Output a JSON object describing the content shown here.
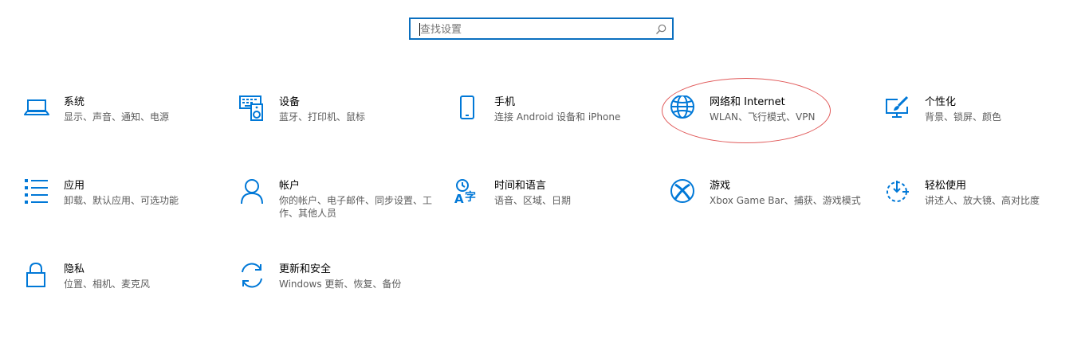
{
  "search": {
    "placeholder": "查找设置",
    "icon": "search-icon"
  },
  "accent": "#0078d7",
  "highlight_color": "#e15b5b",
  "tiles": [
    {
      "title": "系统",
      "desc": "显示、声音、通知、电源",
      "icon": "laptop-icon"
    },
    {
      "title": "设备",
      "desc": "蓝牙、打印机、鼠标",
      "icon": "keyboard-speaker-icon"
    },
    {
      "title": "手机",
      "desc": "连接 Android 设备和 iPhone",
      "icon": "phone-icon"
    },
    {
      "title": "网络和 Internet",
      "desc": "WLAN、飞行模式、VPN",
      "icon": "globe-icon"
    },
    {
      "title": "个性化",
      "desc": "背景、锁屏、颜色",
      "icon": "paint-monitor-icon"
    },
    {
      "title": "应用",
      "desc": "卸载、默认应用、可选功能",
      "icon": "app-list-icon"
    },
    {
      "title": "帐户",
      "desc": "你的帐户、电子邮件、同步设置、工作、其他人员",
      "icon": "person-icon"
    },
    {
      "title": "时间和语言",
      "desc": "语音、区域、日期",
      "icon": "time-language-icon"
    },
    {
      "title": "游戏",
      "desc": "Xbox Game Bar、捕获、游戏模式",
      "icon": "xbox-icon"
    },
    {
      "title": "轻松使用",
      "desc": "讲述人、放大镜、高对比度",
      "icon": "ease-of-access-icon"
    },
    {
      "title": "隐私",
      "desc": "位置、相机、麦克风",
      "icon": "lock-icon"
    },
    {
      "title": "更新和安全",
      "desc": "Windows 更新、恢复、备份",
      "icon": "sync-icon"
    }
  ]
}
